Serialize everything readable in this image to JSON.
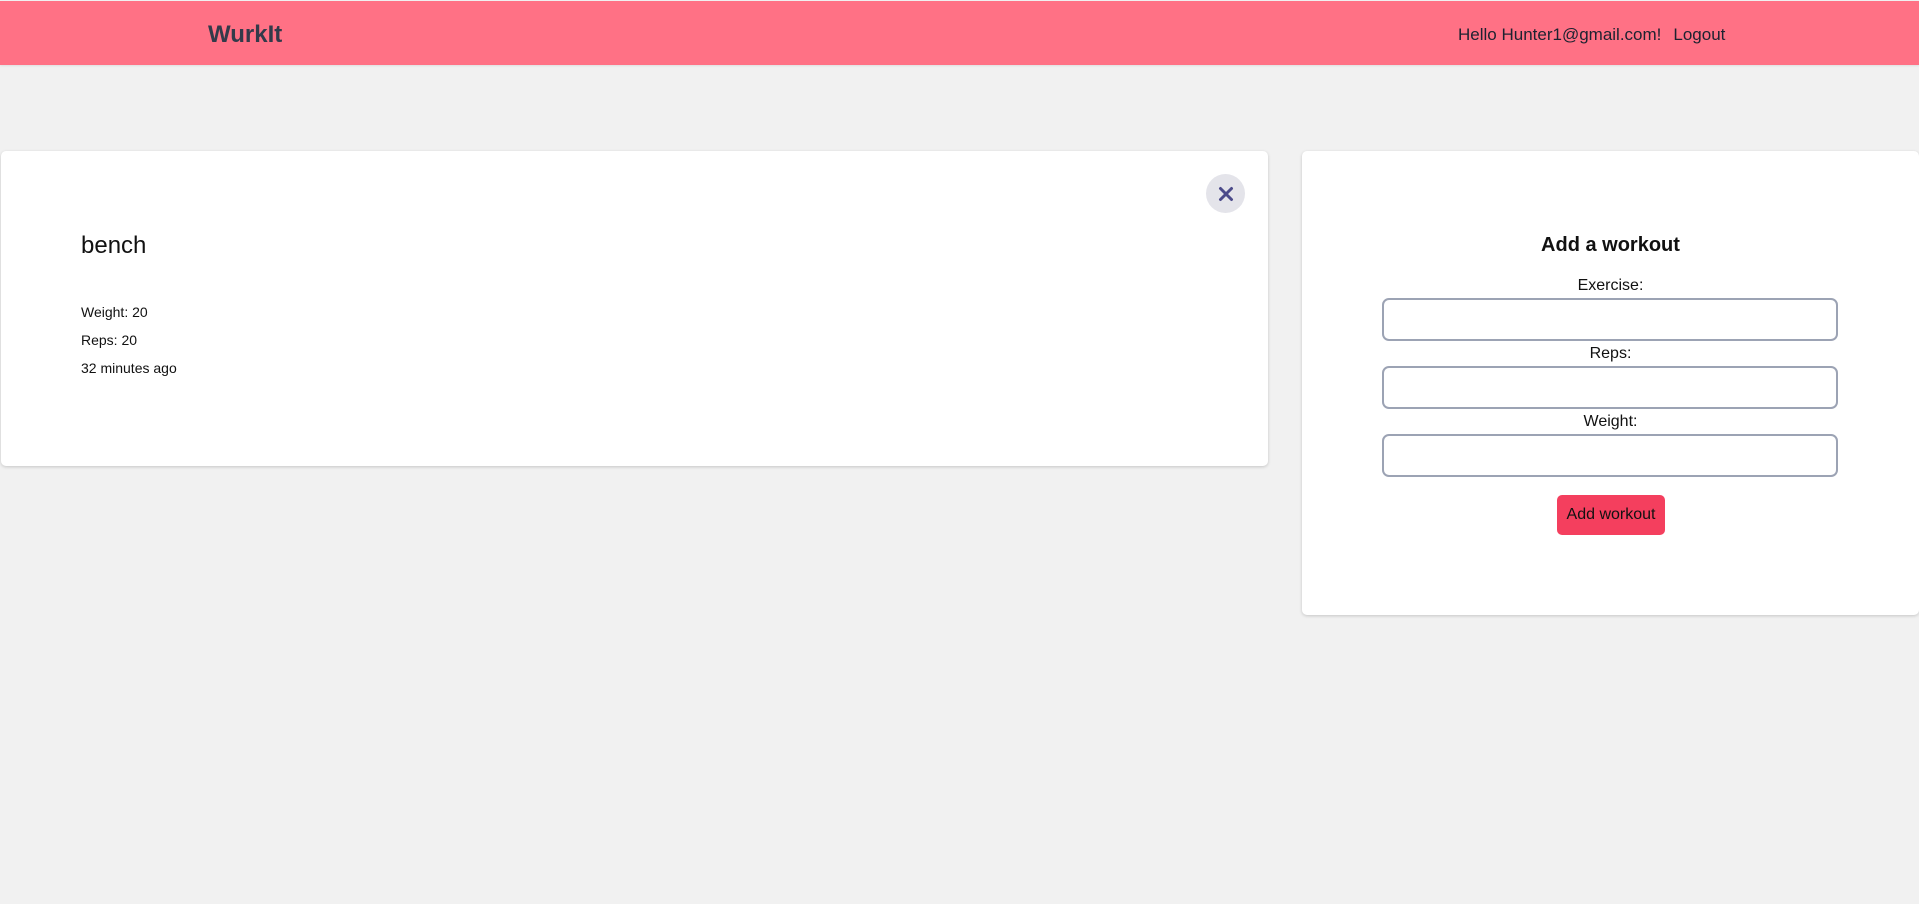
{
  "app": {
    "title": "WurkIt"
  },
  "header": {
    "greeting": "Hello Hunter1@gmail.com!",
    "logout_label": "Logout",
    "colors": {
      "background": "#ff7185",
      "text": "#333a4a"
    }
  },
  "workout_card": {
    "exercise": "bench",
    "weight": "Weight: 20",
    "reps": "Reps: 20",
    "time_ago": "32 minutes ago",
    "delete_icon": "close-icon"
  },
  "form": {
    "title": "Add a workout",
    "exercise_label": "Exercise:",
    "exercise_value": "",
    "reps_label": "Reps:",
    "reps_value": "",
    "weight_label": "Weight:",
    "weight_value": "",
    "submit_label": "Add workout",
    "colors": {
      "submit": "#f43f5e"
    }
  }
}
